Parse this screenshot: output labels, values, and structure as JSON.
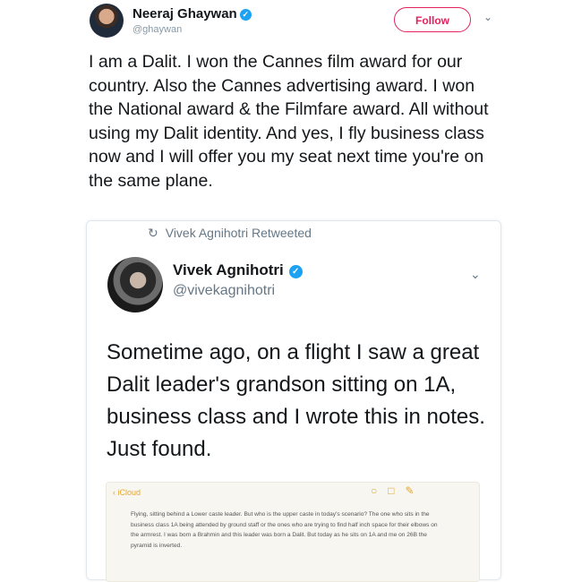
{
  "tweet": {
    "author_name": "Neeraj Ghaywan",
    "handle": "@ghaywan",
    "follow_label": "Follow",
    "text": "I am a Dalit. I won the Cannes film award for our country. Also the Cannes advertising award. I won the National award & the Filmfare award. All without using my Dalit identity. And yes, I fly business class now and I will offer you my seat next time you're on the same plane."
  },
  "retweet": {
    "label": "Vivek Agnihotri Retweeted",
    "author_name": "Vivek Agnihotri",
    "handle": "@vivekagnihotri",
    "text": "Sometime ago, on a flight I saw a great Dalit leader's grandson sitting on 1A, business class and I wrote this in notes. Just found."
  },
  "notes": {
    "back_label": "iCloud",
    "text": "Flying, sitting behind a Lower caste leader. But who is the upper caste in today's scenario? The one who sits in the business class 1A being attended by ground staff or the ones who are trying to find half inch space for their elbows on the armrest. I was born a Brahmin and this leader was born a Dalit. But today as he sits on 1A and me on 26B the pyramid is inverted."
  },
  "colors": {
    "follow": "#e0245e",
    "verified": "#1da1f2",
    "notes_accent": "#e2a72f"
  },
  "icons": [
    "verified-badge-icon",
    "chevron-down-icon",
    "retweet-icon",
    "back-chevron-icon",
    "share-icon",
    "trash-icon",
    "compose-icon"
  ]
}
